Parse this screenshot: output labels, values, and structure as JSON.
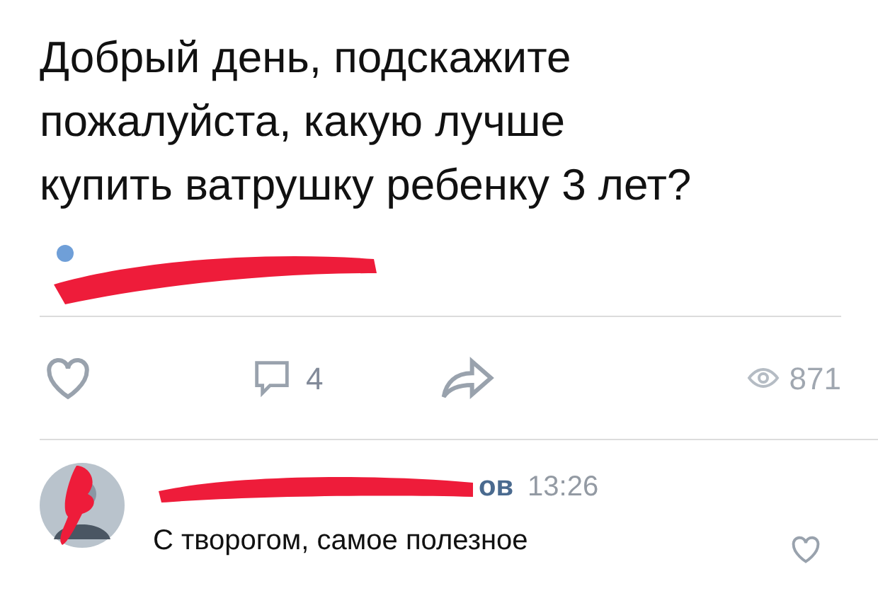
{
  "post": {
    "text": "Добрый день, подскажите пожалуйста, какую лучше купить ватрушку ребенку 3 лет?"
  },
  "actions": {
    "liked": false,
    "comments": "4",
    "views": "871"
  },
  "comment": {
    "author": "ов",
    "time": "13:26",
    "text": "С творогом, самое полезное",
    "liked": false
  }
}
